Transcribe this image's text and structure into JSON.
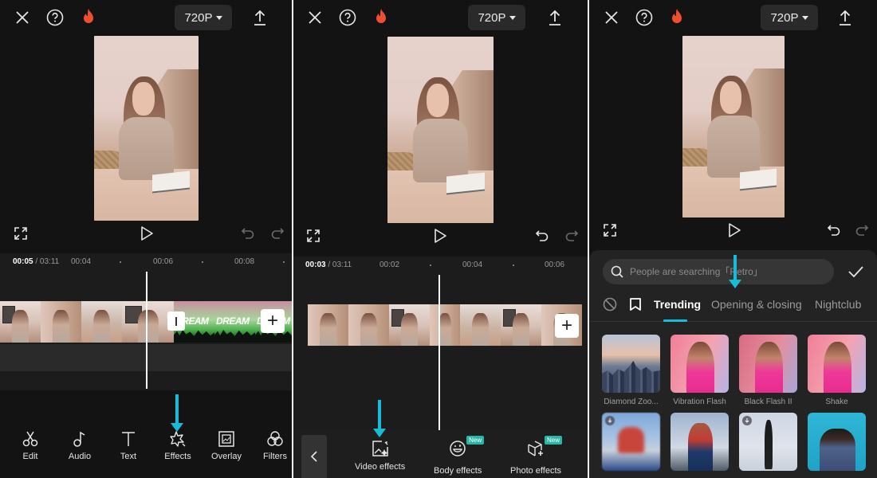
{
  "panels": [
    {
      "topbar": {
        "resolution": "720P",
        "icons": [
          "close-icon",
          "help-icon",
          "flame-icon",
          "export-icon"
        ]
      },
      "timeline": {
        "current_time": "00:05",
        "separator": " / ",
        "total_time": "03:11",
        "ticks": [
          "00:04",
          "00:06",
          "00:08"
        ]
      },
      "clips": {
        "dream_text": "DREAM"
      },
      "toolbar": [
        {
          "label": "Edit",
          "icon": "scissors-icon"
        },
        {
          "label": "Audio",
          "icon": "music-note-icon"
        },
        {
          "label": "Text",
          "icon": "text-icon"
        },
        {
          "label": "Effects",
          "icon": "effects-star-icon"
        },
        {
          "label": "Overlay",
          "icon": "overlay-icon"
        },
        {
          "label": "Filters",
          "icon": "filters-icon"
        }
      ]
    },
    {
      "topbar": {
        "resolution": "720P",
        "icons": [
          "close-icon",
          "help-icon",
          "flame-icon",
          "export-icon"
        ]
      },
      "timeline": {
        "current_time": "00:03",
        "separator": " / ",
        "total_time": "03:11",
        "ticks": [
          "00:02",
          "00:04",
          "00:06"
        ]
      },
      "effects_menu": [
        {
          "label": "Video effects",
          "icon": "video-effects-icon",
          "badge": ""
        },
        {
          "label": "Body effects",
          "icon": "body-effects-icon",
          "badge": "New"
        },
        {
          "label": "Photo effects",
          "icon": "photo-effects-icon",
          "badge": "New"
        }
      ]
    },
    {
      "topbar": {
        "resolution": "720P",
        "icons": [
          "close-icon",
          "help-icon",
          "flame-icon",
          "export-icon"
        ]
      },
      "search": {
        "placeholder": "People are searching「Retro」"
      },
      "tabs": [
        {
          "label": "Trending",
          "active": true
        },
        {
          "label": "Opening & closing",
          "active": false
        },
        {
          "label": "Nightclub",
          "active": false
        }
      ],
      "effects": [
        {
          "name": "Diamond Zoo...",
          "thumb": "city",
          "downloadable": false
        },
        {
          "name": "Vibration Flash",
          "thumb": "pink",
          "downloadable": false
        },
        {
          "name": "Black Flash II",
          "thumb": "pink-dark",
          "downloadable": false
        },
        {
          "name": "Shake",
          "thumb": "pink",
          "downloadable": false
        },
        {
          "name": "",
          "thumb": "blur",
          "downloadable": true
        },
        {
          "name": "",
          "thumb": "street",
          "downloadable": false
        },
        {
          "name": "",
          "thumb": "studio",
          "downloadable": true
        },
        {
          "name": "",
          "thumb": "teal",
          "downloadable": false
        }
      ]
    }
  ],
  "colors": {
    "accent": "#16bcd8",
    "background": "#131313",
    "badge": "#28b7a7",
    "flame": "#ef4f2f"
  }
}
